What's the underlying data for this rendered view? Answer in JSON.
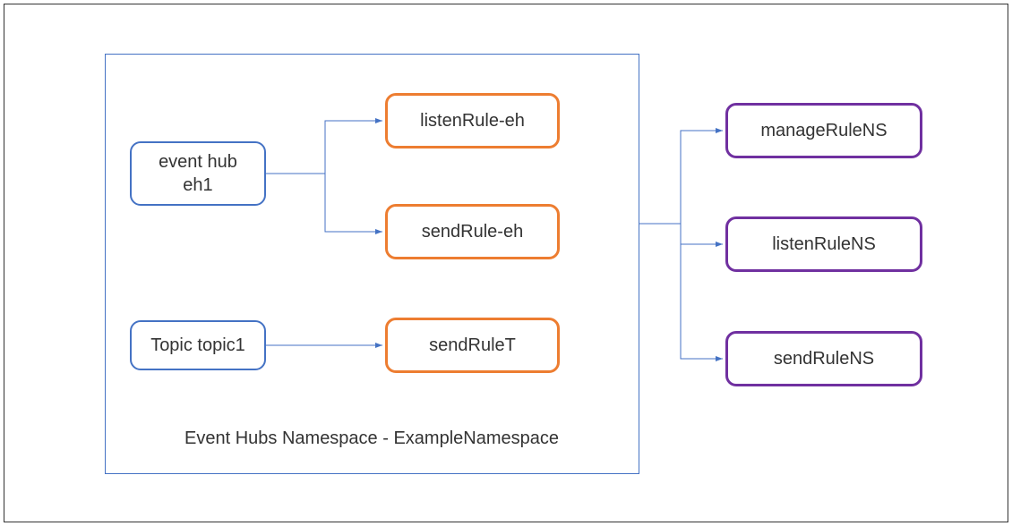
{
  "namespace": {
    "label": "Event Hubs Namespace - ExampleNamespace"
  },
  "entities": {
    "eventhub": {
      "label": "event hub\neh1"
    },
    "topic": {
      "label": "Topic topic1"
    }
  },
  "entity_rules": {
    "listen_eh": {
      "label": "listenRule-eh"
    },
    "send_eh": {
      "label": "sendRule-eh"
    },
    "send_t": {
      "label": "sendRuleT"
    }
  },
  "namespace_rules": {
    "manage": {
      "label": "manageRuleNS"
    },
    "listen": {
      "label": "listenRuleNS"
    },
    "send": {
      "label": "sendRuleNS"
    }
  }
}
